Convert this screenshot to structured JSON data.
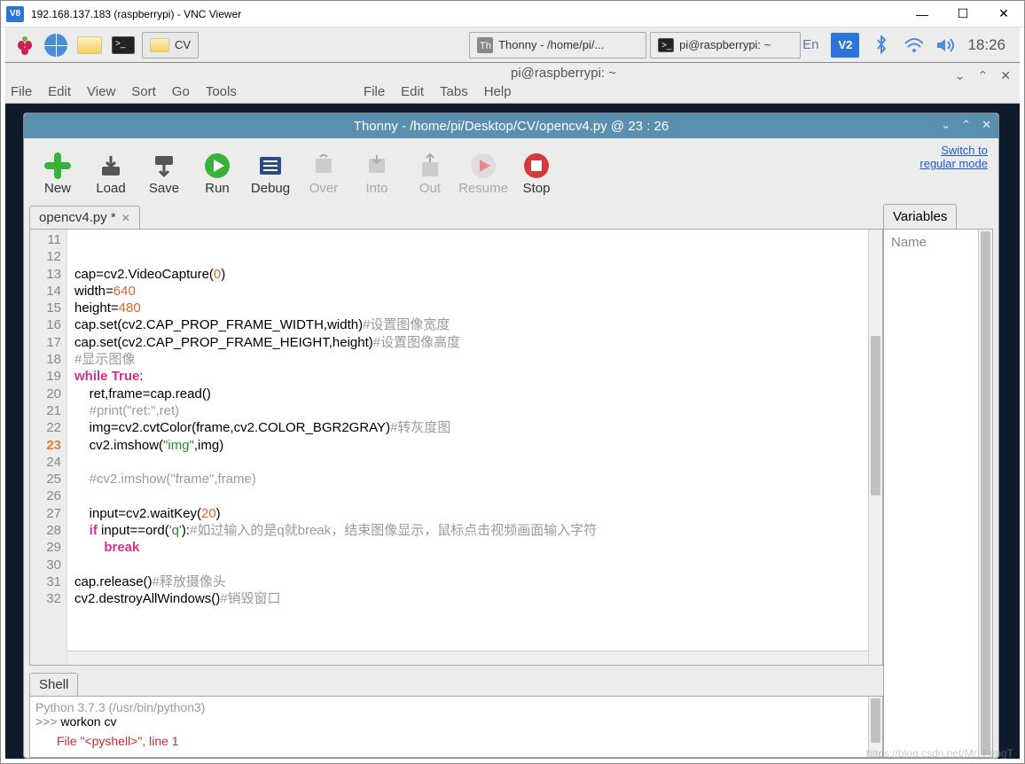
{
  "vnc": {
    "title": "192.168.137.183 (raspberrypi) - VNC Viewer",
    "min": "—",
    "max": "☐",
    "close": "✕"
  },
  "pi_taskbar": {
    "folder_task": "CV",
    "tasks": [
      "Thonny  -  /home/pi/...",
      "pi@raspberrypi: ~"
    ],
    "lang": "En",
    "clock": "18:26"
  },
  "bg": {
    "term_title": "pi@raspberrypi: ~",
    "ctrls": [
      "⌄",
      "⌃",
      "✕"
    ],
    "menu1": [
      "File",
      "Edit",
      "View",
      "Sort",
      "Go",
      "Tools"
    ],
    "menu2": [
      "File",
      "Edit",
      "Tabs",
      "Help"
    ]
  },
  "thonny": {
    "title": "Thonny  -  /home/pi/Desktop/CV/opencv4.py  @  23 : 26",
    "link1": "Switch to",
    "link2": "regular mode",
    "toolbar": {
      "new": "New",
      "load": "Load",
      "save": "Save",
      "run": "Run",
      "debug": "Debug",
      "over": "Over",
      "into": "Into",
      "out": "Out",
      "resume": "Resume",
      "stop": "Stop"
    },
    "tab": "opencv4.py *",
    "variables": "Variables",
    "var_name": "Name"
  },
  "code": {
    "line_start": 11,
    "current_line": 23,
    "lines": [
      "",
      "",
      "cap=cv2.VideoCapture(0)",
      "width=640",
      "height=480",
      "cap.set(cv2.CAP_PROP_FRAME_WIDTH,width)#设置图像宽度",
      "cap.set(cv2.CAP_PROP_FRAME_HEIGHT,height)#设置图像高度",
      "#显示图像",
      "while True:",
      "    ret,frame=cap.read()",
      "    #print(\"ret:\",ret)",
      "    img=cv2.cvtColor(frame,cv2.COLOR_BGR2GRAY)#转灰度图",
      "    cv2.imshow(\"img\",img)",
      "",
      "    #cv2.imshow(\"frame\",frame)",
      "",
      "    input=cv2.waitKey(20)",
      "    if input==ord('q'):#如过输入的是q就break，结束图像显示，鼠标点击视频画面输入字符",
      "        break",
      "",
      "cap.release()#释放摄像头",
      "cv2.destroyAllWindows()#销毁窗口"
    ]
  },
  "shell": {
    "label": "Shell",
    "header": "Python 3.7.3 (/usr/bin/python3)",
    "prompt": ">>> ",
    "cmd": " workon cv",
    "err": "File \"<pyshell>\", line 1"
  },
  "watermark": "https://blog.csdn.net/Mr_FengT"
}
